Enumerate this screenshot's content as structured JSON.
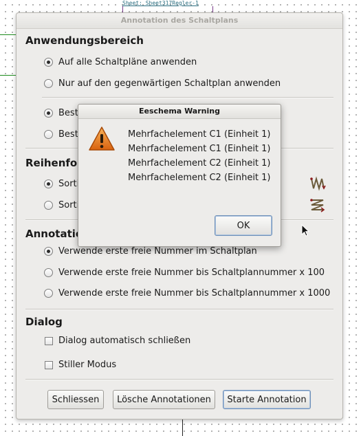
{
  "canvas": {
    "sheet_label": "Sheet: Sheet317Regler-1"
  },
  "dialog": {
    "title": "Annotation des Schaltplans",
    "sections": {
      "scope": {
        "heading": "Anwendungsbereich",
        "options": [
          {
            "label": "Auf alle Schaltpläne anwenden",
            "selected": true
          },
          {
            "label": "Nur auf den gegenwärtigen Schaltplan anwenden",
            "selected": false
          }
        ],
        "options2": [
          {
            "label": "Best",
            "selected": true
          },
          {
            "label": "Best",
            "selected": false
          }
        ]
      },
      "order": {
        "heading": "Reihenfol",
        "options": [
          {
            "label": "Sorti",
            "selected": true,
            "icon": "sort-x-icon"
          },
          {
            "label": "Sorti",
            "selected": false,
            "icon": "sort-y-icon"
          }
        ]
      },
      "annotation": {
        "heading": "Annotatio",
        "options": [
          {
            "label": "Verwende erste freie Nummer im Schaltplan",
            "selected": true
          },
          {
            "label": "Verwende erste freie Nummer bis Schaltplannummer x 100",
            "selected": false
          },
          {
            "label": "Verwende erste freie Nummer bis Schaltplannummer x 1000",
            "selected": false
          }
        ]
      },
      "dialog_opts": {
        "heading": "Dialog",
        "checks": [
          {
            "label": "Dialog automatisch schließen",
            "checked": false
          },
          {
            "label": "Stiller Modus",
            "checked": false
          }
        ]
      }
    },
    "buttons": {
      "close": "Schliessen",
      "clear": "Lösche Annotationen",
      "start": "Starte Annotation"
    }
  },
  "warning": {
    "title": "Eeschema Warning",
    "icon": "warning-icon",
    "messages": [
      "Mehrfachelement C1 (Einheit 1)",
      "Mehrfachelement C1 (Einheit 1)",
      "Mehrfachelement C2 (Einheit 1)",
      "Mehrfachelement C2 (Einheit 1)"
    ],
    "ok_label": "OK"
  },
  "colors": {
    "dialog_bg": "#edecea",
    "wire": "#1a8a1a",
    "focus": "#6f90b8",
    "warning_orange": "#e07a1a"
  }
}
